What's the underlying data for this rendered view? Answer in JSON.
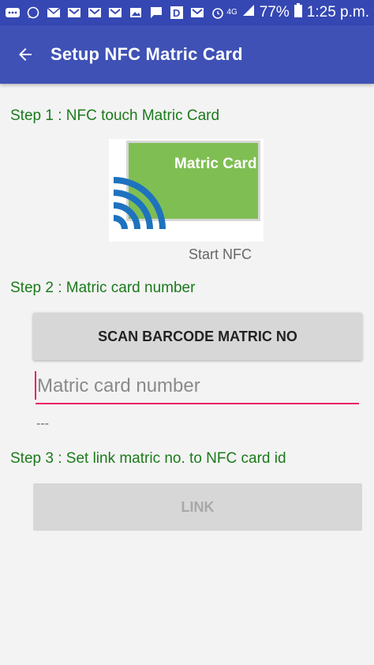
{
  "status_bar": {
    "icons": [
      "more-icon",
      "whatsapp-icon",
      "email-icon",
      "gmail-icon",
      "gmail-icon",
      "gmail-icon",
      "image-icon",
      "sms-icon",
      "d-app-icon",
      "gmail-icon",
      "alarm-icon"
    ],
    "network": "4G",
    "battery": "77%",
    "time": "1:25 p.m."
  },
  "app_bar": {
    "title": "Setup NFC Matric Card",
    "back_icon": "arrow-back-icon"
  },
  "step1": {
    "label": "Step 1 : NFC touch Matric Card",
    "card_text": "Matric Card",
    "start_label": "Start NFC"
  },
  "step2": {
    "label": "Step 2 : Matric card number",
    "scan_button": "SCAN BARCODE MATRIC NO",
    "input_placeholder": "Matric card number",
    "input_value": "",
    "result": "---"
  },
  "step3": {
    "label": "Step 3 : Set link matric no. to NFC card id",
    "link_button": "LINK"
  },
  "colors": {
    "app_bar": "#3f51b5",
    "status_bar": "#3547b3",
    "step_text": "#1b7a1b",
    "accent": "#e91e63",
    "card_green": "#7fbe53",
    "nfc_blue": "#1e73be"
  }
}
